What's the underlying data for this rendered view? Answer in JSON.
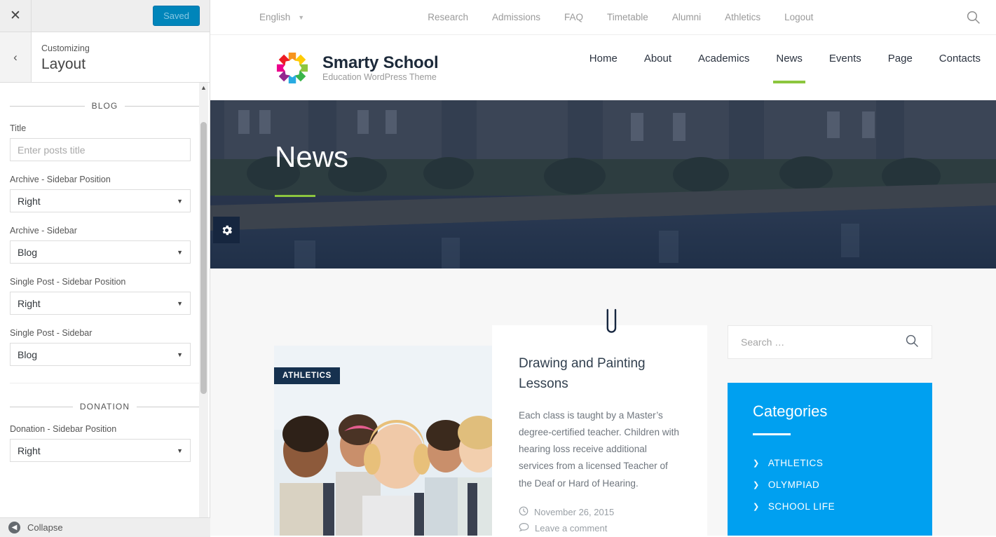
{
  "customizer": {
    "close_label": "✕",
    "save_label": "Saved",
    "back_label": "‹",
    "kicker": "Customizing",
    "title": "Layout",
    "footer_label": "Collapse",
    "sections": [
      {
        "heading": "BLOG",
        "fields": [
          {
            "label": "Title",
            "type": "text",
            "value": "",
            "placeholder": "Enter posts title"
          },
          {
            "label": "Archive - Sidebar Position",
            "type": "select",
            "value": "Right"
          },
          {
            "label": "Archive - Sidebar",
            "type": "select",
            "value": "Blog"
          },
          {
            "label": "Single Post - Sidebar Position",
            "type": "select",
            "value": "Right"
          },
          {
            "label": "Single Post - Sidebar",
            "type": "select",
            "value": "Blog"
          }
        ]
      },
      {
        "heading": "DONATION",
        "fields": [
          {
            "label": "Donation - Sidebar Position",
            "type": "select",
            "value": "Right"
          }
        ]
      }
    ]
  },
  "site": {
    "topbar": {
      "language": "English",
      "links": [
        "Research",
        "Admissions",
        "FAQ",
        "Timetable",
        "Alumni",
        "Athletics",
        "Logout"
      ]
    },
    "brand": {
      "name": "Smarty School",
      "tagline": "Education WordPress Theme"
    },
    "mainnav": [
      {
        "label": "Home",
        "active": false
      },
      {
        "label": "About",
        "active": false
      },
      {
        "label": "Academics",
        "active": false
      },
      {
        "label": "News",
        "active": true
      },
      {
        "label": "Events",
        "active": false
      },
      {
        "label": "Page",
        "active": false
      },
      {
        "label": "Contacts",
        "active": false
      }
    ],
    "hero": {
      "title": "News"
    },
    "post": {
      "category": "ATHLETICS",
      "title": "Drawing and Painting Lessons",
      "excerpt": "Each class is taught by a Master’s degree-certified teacher. Children with hearing loss receive additional services from a licensed Teacher of the Deaf or Hard of Hearing.",
      "date": "November 26, 2015",
      "comments": "Leave a comment"
    },
    "sidebar": {
      "search_placeholder": "Search …",
      "categories_title": "Categories",
      "categories": [
        "ATHLETICS",
        "OLYMPIAD",
        "SCHOOL LIFE"
      ]
    },
    "colors": {
      "accent_green": "#8cc63e",
      "accent_blue": "#00a0f0",
      "navy": "#16314f",
      "save_button": "#0085ba"
    }
  }
}
